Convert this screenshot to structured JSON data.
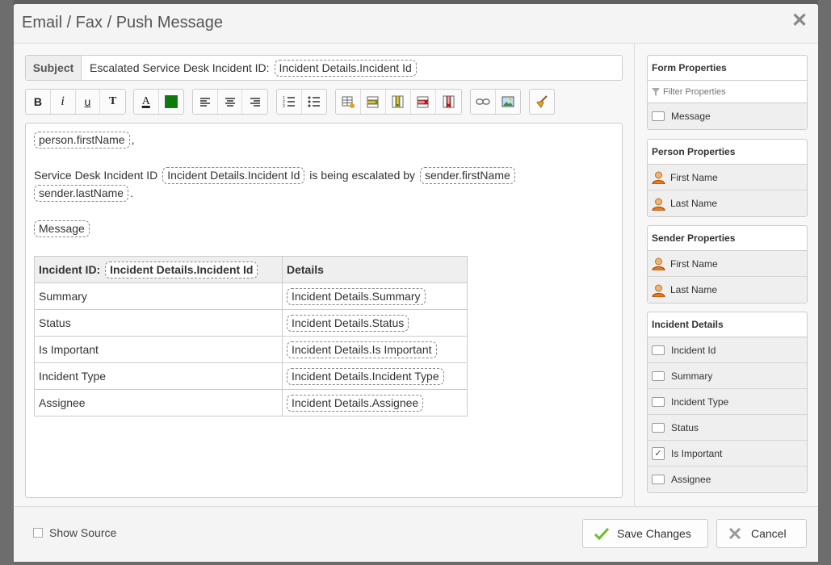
{
  "dialog": {
    "title": "Email / Fax / Push Message",
    "close_icon": "close-icon"
  },
  "subject": {
    "label": "Subject",
    "prefix": "Escalated Service Desk Incident ID:",
    "tag": "Incident Details.Incident Id"
  },
  "toolbar": {
    "bold": "B",
    "italic": "i",
    "underline": "u",
    "remove_format": "T",
    "font_color": "A",
    "highlight_color": "#0a7a0a"
  },
  "editor": {
    "line1_tag": "person.firstName",
    "line1_suffix": ",",
    "line2_prefix": "Service Desk Incident ID",
    "line2_tag1": "Incident Details.Incident Id",
    "line2_mid": "is being escalated by",
    "line2_tag2": "sender.firstName",
    "line3_tag": "sender.lastName",
    "line3_suffix": ".",
    "line4_tag": "Message",
    "table": {
      "header_label": "Incident ID:",
      "header_tag": "Incident Details.Incident Id",
      "header_details": "Details",
      "rows": [
        {
          "label": "Summary",
          "tag": "Incident Details.Summary"
        },
        {
          "label": "Status",
          "tag": "Incident Details.Status"
        },
        {
          "label": "Is Important",
          "tag": "Incident Details.Is Important"
        },
        {
          "label": "Incident Type",
          "tag": "Incident Details.Incident Type"
        },
        {
          "label": "Assignee",
          "tag": "Incident Details.Assignee"
        }
      ]
    }
  },
  "panels": {
    "form": {
      "title": "Form Properties",
      "filter_placeholder": "Filter Properties",
      "items": [
        "Message"
      ]
    },
    "person": {
      "title": "Person Properties",
      "items": [
        "First Name",
        "Last Name"
      ]
    },
    "sender": {
      "title": "Sender Properties",
      "items": [
        "First Name",
        "Last Name"
      ]
    },
    "incident": {
      "title": "Incident Details",
      "items": [
        "Incident Id",
        "Summary",
        "Incident Type",
        "Status",
        "Is Important",
        "Assignee"
      ],
      "checked_item": "Is Important"
    }
  },
  "footer": {
    "show_source": "Show Source",
    "save": "Save Changes",
    "cancel": "Cancel"
  }
}
